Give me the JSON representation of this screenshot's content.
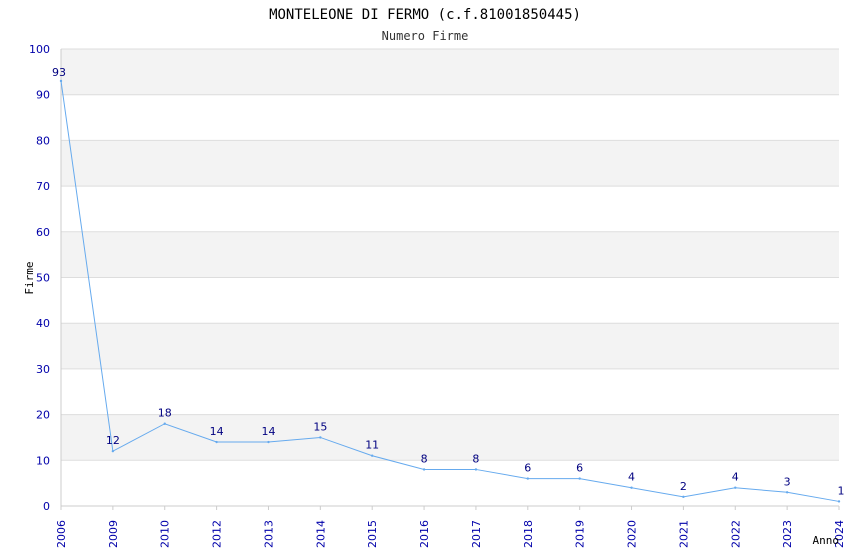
{
  "chart_data": {
    "type": "line",
    "title": "MONTELEONE DI FERMO (c.f.81001850445)",
    "subtitle": "Numero Firme",
    "xlabel": "Anno",
    "ylabel": "Firme",
    "categories": [
      "2006",
      "2009",
      "2010",
      "2012",
      "2013",
      "2014",
      "2015",
      "2016",
      "2017",
      "2018",
      "2019",
      "2020",
      "2021",
      "2022",
      "2023",
      "2024"
    ],
    "values": [
      93,
      12,
      18,
      14,
      14,
      15,
      11,
      8,
      8,
      6,
      6,
      4,
      2,
      4,
      3,
      1
    ],
    "ylim": [
      0,
      100
    ],
    "yticks": [
      0,
      10,
      20,
      30,
      40,
      50,
      60,
      70,
      80,
      90,
      100
    ],
    "grid": true,
    "line_color": "#66aaee",
    "band_color": "#f3f3f3",
    "tick_color": "#0000aa",
    "label_color": "#000080"
  }
}
